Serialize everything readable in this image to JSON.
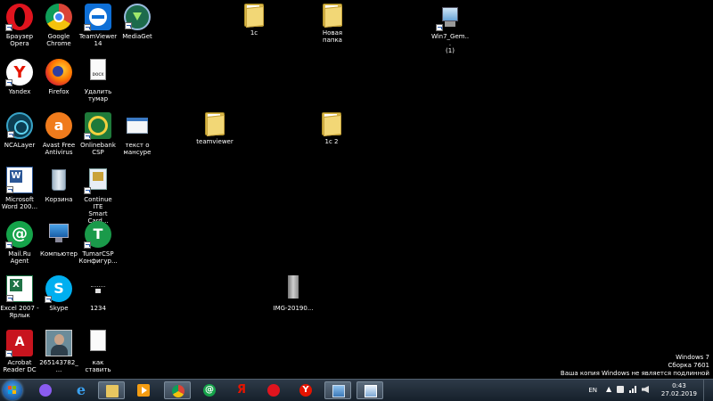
{
  "desktop": {
    "icons": {
      "opera": "Браузер\nOpera",
      "chrome": "Google\nChrome",
      "teamviewer14": "TeamViewer\n14",
      "mediaget": "MediaGet",
      "folder_1c": "1c",
      "new_folder": "Новая папка",
      "win7_gem": "Win7_Gem...\n(1)",
      "yandex": "Yandex",
      "firefox": "Firefox",
      "delete_tumar": "Удалить\nтумар",
      "ncalayer": "NCALayer",
      "avast": "Avast Free\nAntivirus",
      "onlinebank": "Onlinebank\nCSP",
      "text_mansur": "текст о\nмансуре",
      "teamviewer_folder": "teamviewer",
      "folder_1c2": "1c 2",
      "word": "Microsoft\nWord 200...",
      "recycle": "Корзина",
      "continue": "Continue ITE\nSmart Card...",
      "mailru": "Mail.Ru\nAgent",
      "computer": "Компьютер",
      "tumarcsp": "TumarCSP\nКонфигур...",
      "excel": "Excel 2007 -\nЯрлык",
      "skype": "Skype",
      "file_1234": "1234",
      "img": "IMG-20190...",
      "acrobat": "Acrobat\nReader DC",
      "photo": "265143782_...",
      "kak_stavit": "как ставить"
    },
    "doc_badge": "DOCX"
  },
  "watermark": {
    "line1": "Windows 7",
    "line2": "Сборка 7601",
    "line3": "Ваша копия Windows не является подлинной"
  },
  "taskbar": {
    "language": "EN",
    "time": "0:43",
    "date": "27.02.2019"
  },
  "colors": {
    "desktop": "#000000",
    "taskbar": "#1e2935",
    "opera": "#e0141e",
    "chrome_red": "#db4437",
    "chrome_yellow": "#f4c20d",
    "chrome_green": "#0f9d58",
    "chrome_blue": "#4285f4",
    "teamviewer": "#0e6fd6",
    "yandex": "#e61400",
    "mailru": "#15a34a",
    "skype": "#00aff0",
    "excel": "#1f7346",
    "word": "#2b5797",
    "acrobat": "#c8141e",
    "avast": "#f07b1c"
  }
}
